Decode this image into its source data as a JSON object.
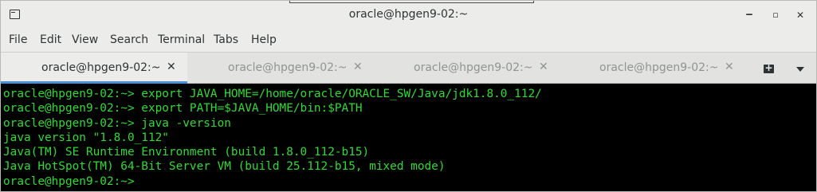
{
  "window": {
    "title": "oracle@hpgen9-02:~",
    "controls": {
      "minimize": "‒",
      "maximize": "▫",
      "close": "✕"
    }
  },
  "menu": [
    "File",
    "Edit",
    "View",
    "Search",
    "Terminal",
    "Tabs",
    "Help"
  ],
  "tabs": [
    {
      "label": "oracle@hpgen9-02:~",
      "close": "✕",
      "active": true
    },
    {
      "label": "oracle@hpgen9-02:~",
      "close": "✕",
      "active": false
    },
    {
      "label": "oracle@hpgen9-02:~",
      "close": "✕",
      "active": false
    },
    {
      "label": "oracle@hpgen9-02:~",
      "close": "✕",
      "active": false
    }
  ],
  "terminal": {
    "colors": {
      "background": "#000000",
      "text": "#2ddc31"
    },
    "lines": [
      "oracle@hpgen9-02:~> export JAVA_HOME=/home/oracle/ORACLE_SW/Java/jdk1.8.0_112/",
      "oracle@hpgen9-02:~> export PATH=$JAVA_HOME/bin:$PATH",
      "oracle@hpgen9-02:~> java -version",
      "java version \"1.8.0_112\"",
      "Java(TM) SE Runtime Environment (build 1.8.0_112-b15)",
      "Java HotSpot(TM) 64-Bit Server VM (build 25.112-b15, mixed mode)",
      "oracle@hpgen9-02:~>"
    ]
  },
  "icons": {
    "window": "terminal-window-icon",
    "new_tab": "new-tab-icon",
    "menu": "chevron-down-icon"
  }
}
